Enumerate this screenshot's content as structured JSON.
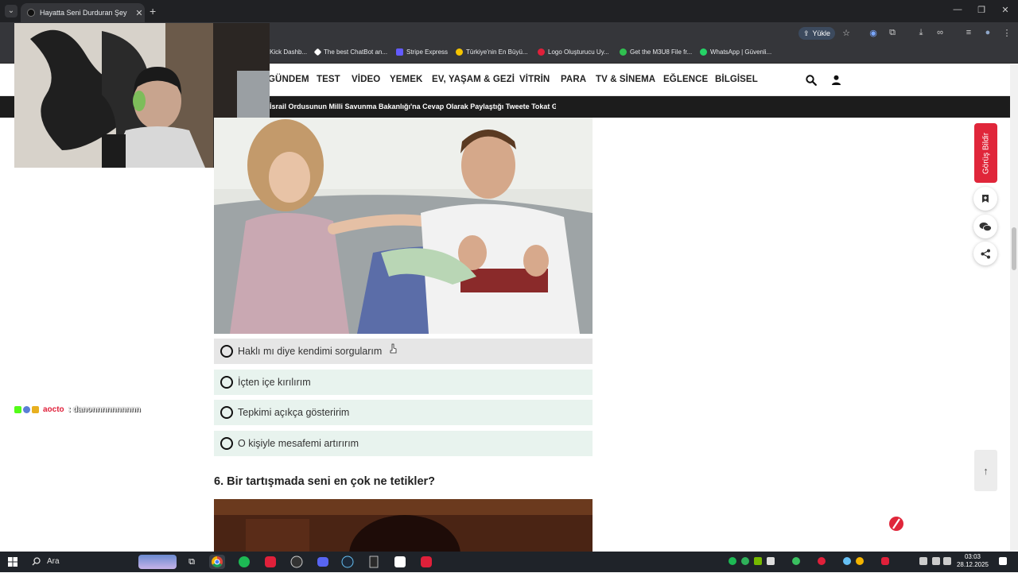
{
  "browser": {
    "tab_title": "Hayatta Seni Durduran Şey Ne?",
    "upload_label": "Yükle",
    "bookmarks": [
      {
        "label": "Kick Dashb...",
        "color": "#2b2b2b"
      },
      {
        "label": "The best ChatBot an...",
        "color": "#ffffff"
      },
      {
        "label": "Stripe Express",
        "color": "#635bff"
      },
      {
        "label": "Türkiye'nin En Büyü...",
        "color": "#f5c400"
      },
      {
        "label": "Logo Oluşturucu Uy...",
        "color": "#e0203a"
      },
      {
        "label": "Get the M3U8 File fr...",
        "color": "#30c050"
      },
      {
        "label": "WhatsApp | Güvenli...",
        "color": "#25d366"
      }
    ]
  },
  "site": {
    "nav": [
      "GÜNDEM",
      "TEST",
      "VİDEO",
      "YEMEK",
      "EV, YAŞAM & GEZİ",
      "VİTRİN",
      "PARA",
      "TV & SİNEMA",
      "EĞLENCE",
      "BİLGİSEL"
    ],
    "ticker": "İsrail Ordusunun Milli Savunma Bakanlığı'na Cevap Olarak Paylaştığı Tweete Tokat Gibi Yanıt Geldi",
    "options": [
      "Haklı mı diye kendimi sorgularım",
      "İçten içe kırılırım",
      "Tepkimi açıkça gösteririm",
      "O kişiyle mesafemi artırırım"
    ],
    "question6": "6. Bir tartışmada seni en çok ne tetikler?",
    "feedback_label": "Görüş Bildir"
  },
  "chat": {
    "user": "aocto",
    "message": ": danonnnnnnnnnn"
  },
  "taskbar": {
    "search_label": "Ara",
    "time": "03:03",
    "date": "28.12.2025"
  },
  "colors": {
    "brand_red": "#e0263a",
    "option_bg": "#e8f3ee",
    "ticker_bg": "#1c1c1c"
  }
}
